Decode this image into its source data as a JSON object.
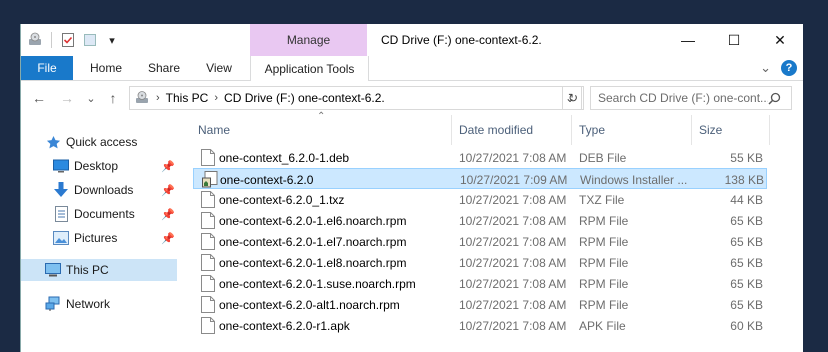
{
  "window": {
    "title": "CD Drive (F:) one-context-6.2.",
    "contextual_group": "Manage",
    "controls": {
      "minimize": "—",
      "maximize": "☐",
      "close": "✕"
    }
  },
  "quick_access_toolbar": {
    "dropdown": "▾"
  },
  "ribbon": {
    "tabs": [
      "File",
      "Home",
      "Share",
      "View",
      "Application Tools"
    ],
    "collapse": "⌄",
    "help": "?"
  },
  "address_bar": {
    "back": "←",
    "forward": "→",
    "recent": "⌄",
    "up": "↑",
    "breadcrumbs": [
      "This PC",
      "CD Drive (F:) one-context-6.2."
    ],
    "separator": "›",
    "dropdown": "⌄",
    "refresh": "↻",
    "search_placeholder": "Search CD Drive (F:) one-cont..."
  },
  "nav_pane": {
    "items": [
      {
        "label": "Quick access",
        "icon": "star-icon",
        "pinned": false
      },
      {
        "label": "Desktop",
        "icon": "desktop-icon",
        "pinned": true
      },
      {
        "label": "Downloads",
        "icon": "download-arrow-icon",
        "pinned": true
      },
      {
        "label": "Documents",
        "icon": "documents-icon",
        "pinned": true
      },
      {
        "label": "Pictures",
        "icon": "pictures-icon",
        "pinned": true
      },
      {
        "label": "This PC",
        "icon": "computer-icon",
        "pinned": false,
        "selected": true
      },
      {
        "label": "Network",
        "icon": "network-icon",
        "pinned": false
      }
    ],
    "pin_glyph": "📌"
  },
  "file_list": {
    "columns": {
      "name": "Name",
      "date": "Date modified",
      "type": "Type",
      "size": "Size"
    },
    "sort_glyph": "⌃",
    "rows": [
      {
        "name": "one-context_6.2.0-1.deb",
        "date": "10/27/2021 7:08 AM",
        "type": "DEB File",
        "size": "55 KB",
        "icon": "file-icon"
      },
      {
        "name": "one-context-6.2.0",
        "date": "10/27/2021 7:09 AM",
        "type": "Windows Installer ...",
        "size": "138 KB",
        "icon": "msi-installer-icon",
        "selected": true
      },
      {
        "name": "one-context-6.2.0_1.txz",
        "date": "10/27/2021 7:08 AM",
        "type": "TXZ File",
        "size": "44 KB",
        "icon": "file-icon"
      },
      {
        "name": "one-context-6.2.0-1.el6.noarch.rpm",
        "date": "10/27/2021 7:08 AM",
        "type": "RPM File",
        "size": "65 KB",
        "icon": "file-icon"
      },
      {
        "name": "one-context-6.2.0-1.el7.noarch.rpm",
        "date": "10/27/2021 7:08 AM",
        "type": "RPM File",
        "size": "65 KB",
        "icon": "file-icon"
      },
      {
        "name": "one-context-6.2.0-1.el8.noarch.rpm",
        "date": "10/27/2021 7:08 AM",
        "type": "RPM File",
        "size": "65 KB",
        "icon": "file-icon"
      },
      {
        "name": "one-context-6.2.0-1.suse.noarch.rpm",
        "date": "10/27/2021 7:08 AM",
        "type": "RPM File",
        "size": "65 KB",
        "icon": "file-icon"
      },
      {
        "name": "one-context-6.2.0-alt1.noarch.rpm",
        "date": "10/27/2021 7:08 AM",
        "type": "RPM File",
        "size": "65 KB",
        "icon": "file-icon"
      },
      {
        "name": "one-context-6.2.0-r1.apk",
        "date": "10/27/2021 7:08 AM",
        "type": "APK File",
        "size": "60 KB",
        "icon": "file-icon"
      }
    ]
  },
  "colors": {
    "accent": "#1979ca",
    "manage_tab": "#e9c8f2",
    "selection": "#cce8ff",
    "desktop_bg": "#1b2a44"
  }
}
